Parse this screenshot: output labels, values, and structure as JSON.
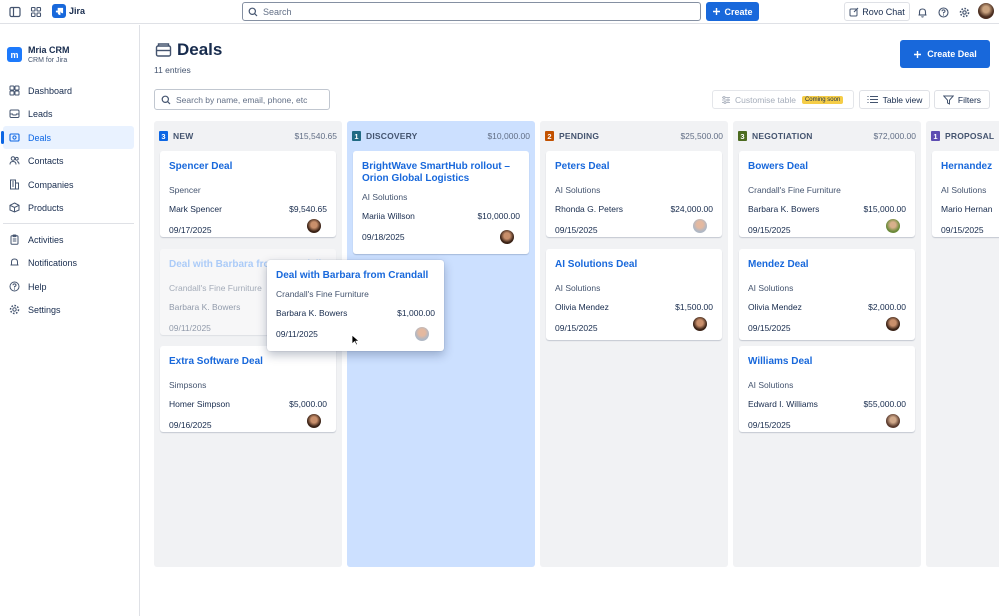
{
  "topbar": {
    "app_name": "Jira",
    "search_placeholder": "Search",
    "create_label": "Create",
    "rovo_label": "Rovo Chat"
  },
  "sidebar": {
    "app_title": "Mria CRM",
    "app_subtitle": "CRM for Jira",
    "logo_letter": "m",
    "items": [
      {
        "label": "Dashboard",
        "icon": "dashboard-icon"
      },
      {
        "label": "Leads",
        "icon": "inbox-icon"
      },
      {
        "label": "Deals",
        "icon": "deals-icon",
        "active": true
      },
      {
        "label": "Contacts",
        "icon": "people-icon"
      },
      {
        "label": "Companies",
        "icon": "building-icon"
      },
      {
        "label": "Products",
        "icon": "box-icon"
      },
      {
        "label": "Activities",
        "icon": "clipboard-icon"
      },
      {
        "label": "Notifications",
        "icon": "bell-icon"
      },
      {
        "label": "Help",
        "icon": "help-icon"
      },
      {
        "label": "Settings",
        "icon": "gear-icon"
      }
    ]
  },
  "page": {
    "title": "Deals",
    "entries": "11 entries",
    "create_deal_label": "Create Deal",
    "search_placeholder": "Search by name, email, phone, etc",
    "customise_label": "Customise table",
    "coming_soon": "Coming soon",
    "table_view_label": "Table view",
    "filters_label": "Filters"
  },
  "columns": [
    {
      "count": "3",
      "name": "NEW",
      "total": "$15,540.65",
      "color": "#0c66e4"
    },
    {
      "count": "1",
      "name": "DISCOVERY",
      "total": "$10,000.00",
      "color": "#206a83"
    },
    {
      "count": "2",
      "name": "PENDING",
      "total": "$25,500.00",
      "color": "#c25100"
    },
    {
      "count": "3",
      "name": "NEGOTIATION",
      "total": "$72,000.00",
      "color": "#4c6b1f"
    },
    {
      "count": "1",
      "name": "PROPOSAL",
      "total": "",
      "color": "#5e4db2"
    }
  ],
  "cards": {
    "new": [
      {
        "title": "Spencer Deal",
        "company": "Spencer",
        "contact": "Mark Spencer",
        "amount": "$9,540.65",
        "date": "09/17/2025"
      },
      {
        "title": "Deal with Barbara from Crandall",
        "company": "Crandall's Fine Furniture",
        "contact": "Barbara K. Bowers",
        "amount": "$1,000.00",
        "date": "09/11/2025"
      },
      {
        "title": "Extra Software Deal",
        "company": "Simpsons",
        "contact": "Homer Simpson",
        "amount": "$5,000.00",
        "date": "09/16/2025"
      }
    ],
    "discovery": [
      {
        "title": "BrightWave SmartHub rollout – Orion Global Logistics",
        "company": "AI Solutions",
        "contact": "Mariia Willson",
        "amount": "$10,000.00",
        "date": "09/18/2025"
      }
    ],
    "pending": [
      {
        "title": "Peters Deal",
        "company": "AI Solutions",
        "contact": "Rhonda G. Peters",
        "amount": "$24,000.00",
        "date": "09/15/2025"
      },
      {
        "title": "AI Solutions Deal",
        "company": "AI Solutions",
        "contact": "Olivia Mendez",
        "amount": "$1,500.00",
        "date": "09/15/2025"
      }
    ],
    "negotiation": [
      {
        "title": "Bowers Deal",
        "company": "Crandall's Fine Furniture",
        "contact": "Barbara K. Bowers",
        "amount": "$15,000.00",
        "date": "09/15/2025"
      },
      {
        "title": "Mendez Deal",
        "company": "AI Solutions",
        "contact": "Olivia Mendez",
        "amount": "$2,000.00",
        "date": "09/15/2025"
      },
      {
        "title": "Williams Deal",
        "company": "AI Solutions",
        "contact": "Edward I. Williams",
        "amount": "$55,000.00",
        "date": "09/15/2025"
      }
    ],
    "proposal": [
      {
        "title": "Hernandez",
        "company": "AI Solutions",
        "contact": "Mario Hernan",
        "date": "09/15/2025"
      }
    ]
  }
}
